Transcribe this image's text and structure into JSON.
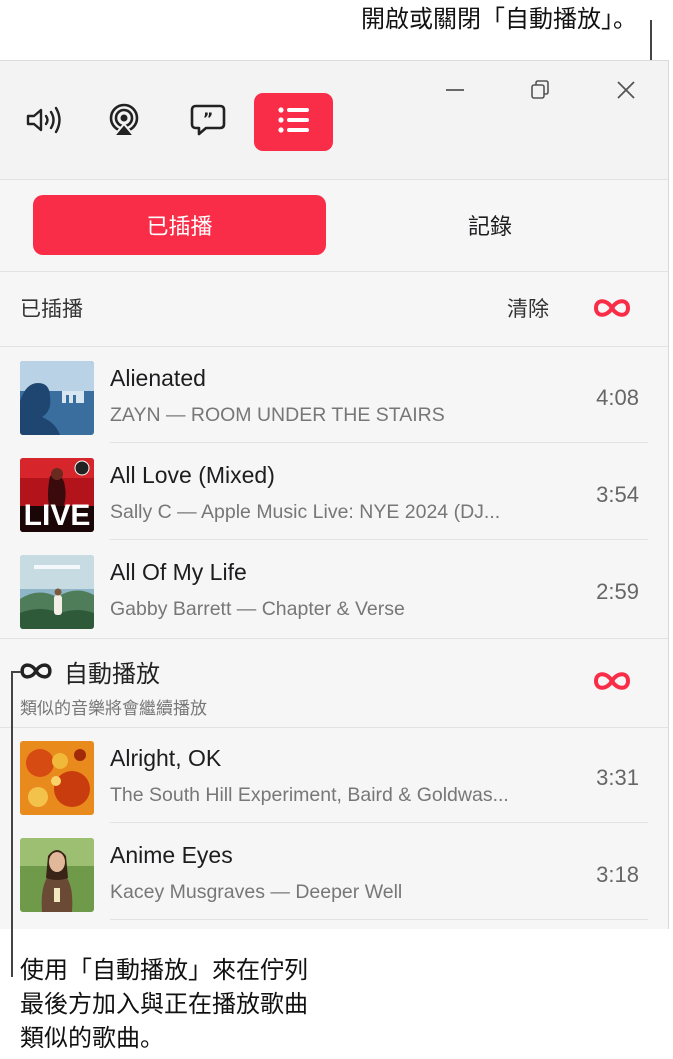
{
  "callouts": {
    "top": "開啟或關閉「自動播放」。",
    "bottom_line1": "使用「自動播放」來在佇列",
    "bottom_line2": "最後方加入與正在播放歌曲",
    "bottom_line3": "類似的歌曲。"
  },
  "toolbar": {
    "buttons": [
      {
        "icon": "speaker-volume-icon"
      },
      {
        "icon": "airplay-icon"
      },
      {
        "icon": "lyrics-icon"
      },
      {
        "icon": "playing-next-list-icon",
        "active": true
      }
    ],
    "window_controls": [
      "minimize-icon",
      "restore-icon",
      "close-icon"
    ]
  },
  "tabs": {
    "playing_next": "已插播",
    "history": "記錄"
  },
  "queue": {
    "section_title": "已插播",
    "clear_label": "清除",
    "items": [
      {
        "title": "Alienated",
        "subtitle": "ZAYN — ROOM UNDER THE STAIRS",
        "duration": "4:08"
      },
      {
        "title": "All Love (Mixed)",
        "subtitle": "Sally C — Apple Music Live: NYE 2024 (DJ...",
        "duration": "3:54",
        "art_text": "LIVE"
      },
      {
        "title": "All Of My Life",
        "subtitle": "Gabby Barrett — Chapter & Verse",
        "duration": "2:59"
      }
    ]
  },
  "autoplay": {
    "title": "自動播放",
    "subtitle": "類似的音樂將會繼續播放",
    "items": [
      {
        "title": "Alright, OK",
        "subtitle": "The South Hill Experiment, Baird & Goldwas...",
        "duration": "3:31"
      },
      {
        "title": "Anime Eyes",
        "subtitle": "Kacey Musgraves — Deeper Well",
        "duration": "3:18"
      }
    ]
  },
  "colors": {
    "accent": "#fa2d48",
    "background": "#f6f6f6"
  }
}
